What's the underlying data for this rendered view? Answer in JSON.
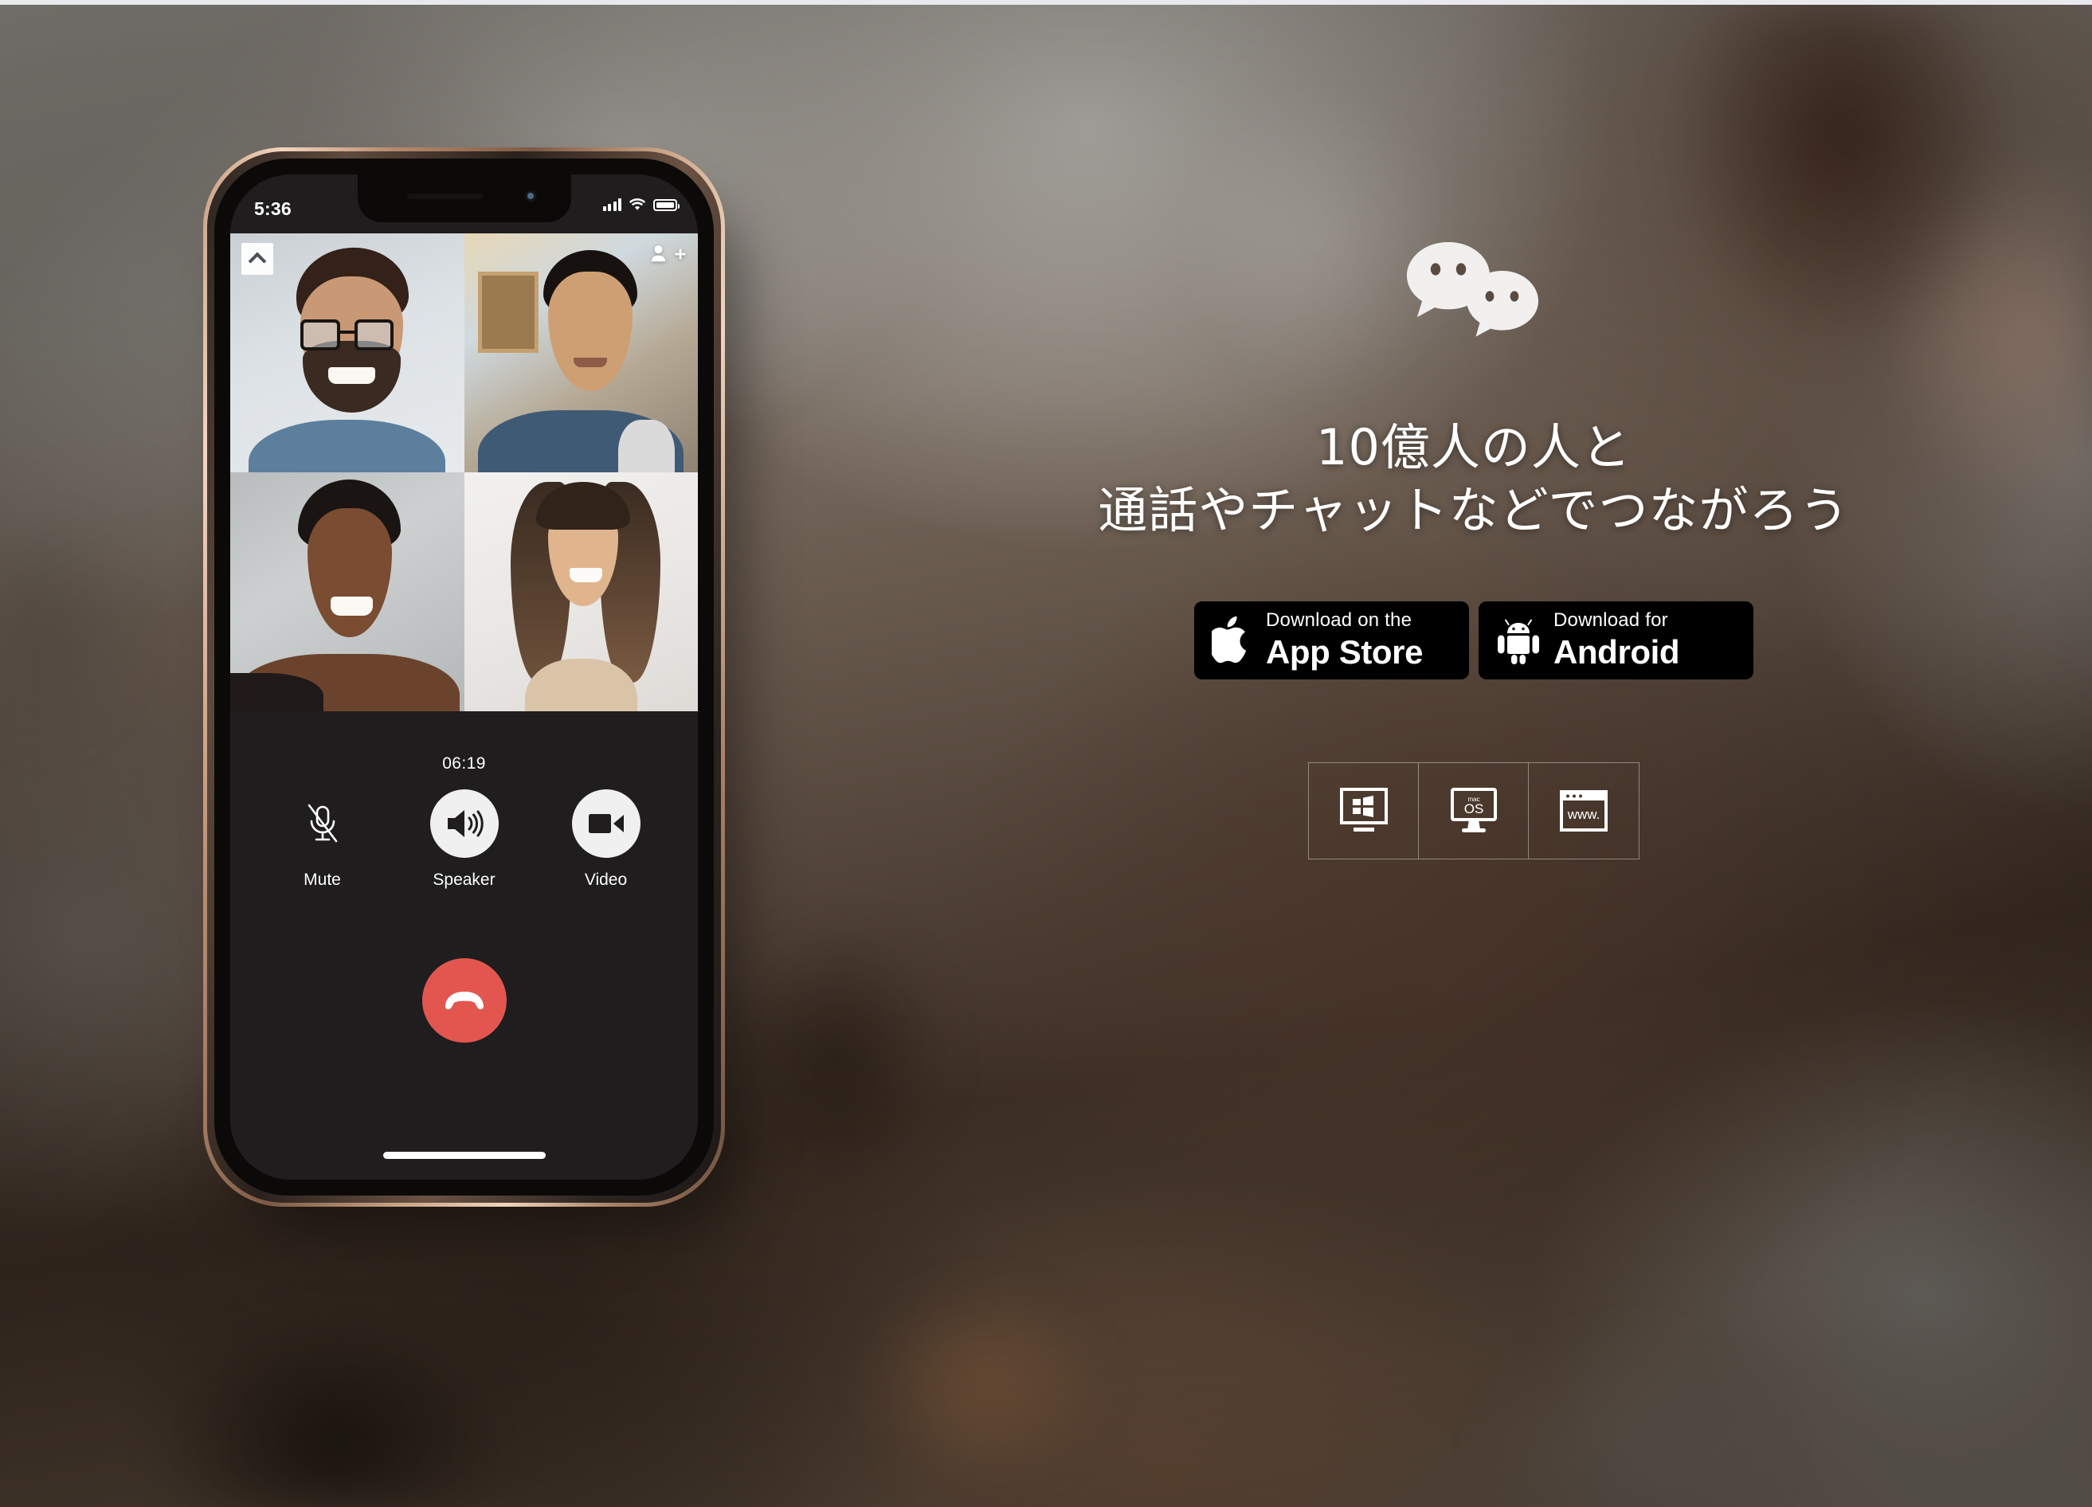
{
  "page": {
    "background_style": "blurred-office-photo",
    "accent_red": "#e2564f",
    "text_color": "#ffffff"
  },
  "phone": {
    "status_bar": {
      "time": "5:36",
      "signal_icon": "cellular-bars-icon",
      "wifi_icon": "wifi-icon",
      "battery_icon": "battery-full-icon"
    },
    "video_call": {
      "collapse_icon": "chevron-up-icon",
      "add_participant_icon": "add-person-icon",
      "participants": [
        {
          "name": "participant-1",
          "desc": "man with glasses"
        },
        {
          "name": "participant-2",
          "desc": "man in blue shirt"
        },
        {
          "name": "participant-3",
          "desc": "woman smiling"
        },
        {
          "name": "participant-4",
          "desc": "woman with long hair"
        }
      ],
      "timer": "06:19",
      "controls": [
        {
          "icon": "microphone-muted-icon",
          "label": "Mute",
          "style": "plain"
        },
        {
          "icon": "speaker-icon",
          "label": "Speaker",
          "style": "circle"
        },
        {
          "icon": "video-camera-icon",
          "label": "Video",
          "style": "circle"
        }
      ],
      "end_call_icon": "hang-up-phone-icon"
    },
    "home_indicator": "home-indicator-bar"
  },
  "hero": {
    "logo_icon": "wechat-bubbles-logo",
    "headline_line1": "10億人の人と",
    "headline_line2": "通話やチャットなどでつながろう",
    "store_buttons": [
      {
        "icon": "apple-logo-icon",
        "top_label": "Download on the",
        "bottom_label": "App Store"
      },
      {
        "icon": "android-robot-icon",
        "top_label": "Download for",
        "bottom_label": "Android"
      }
    ],
    "platforms": [
      {
        "icon": "windows-desktop-icon",
        "label": "Windows"
      },
      {
        "icon": "macos-display-icon",
        "label": "macOS",
        "badge_top": "mac",
        "badge_bottom": "OS"
      },
      {
        "icon": "web-browser-icon",
        "label": "Web",
        "badge": "www."
      }
    ]
  }
}
